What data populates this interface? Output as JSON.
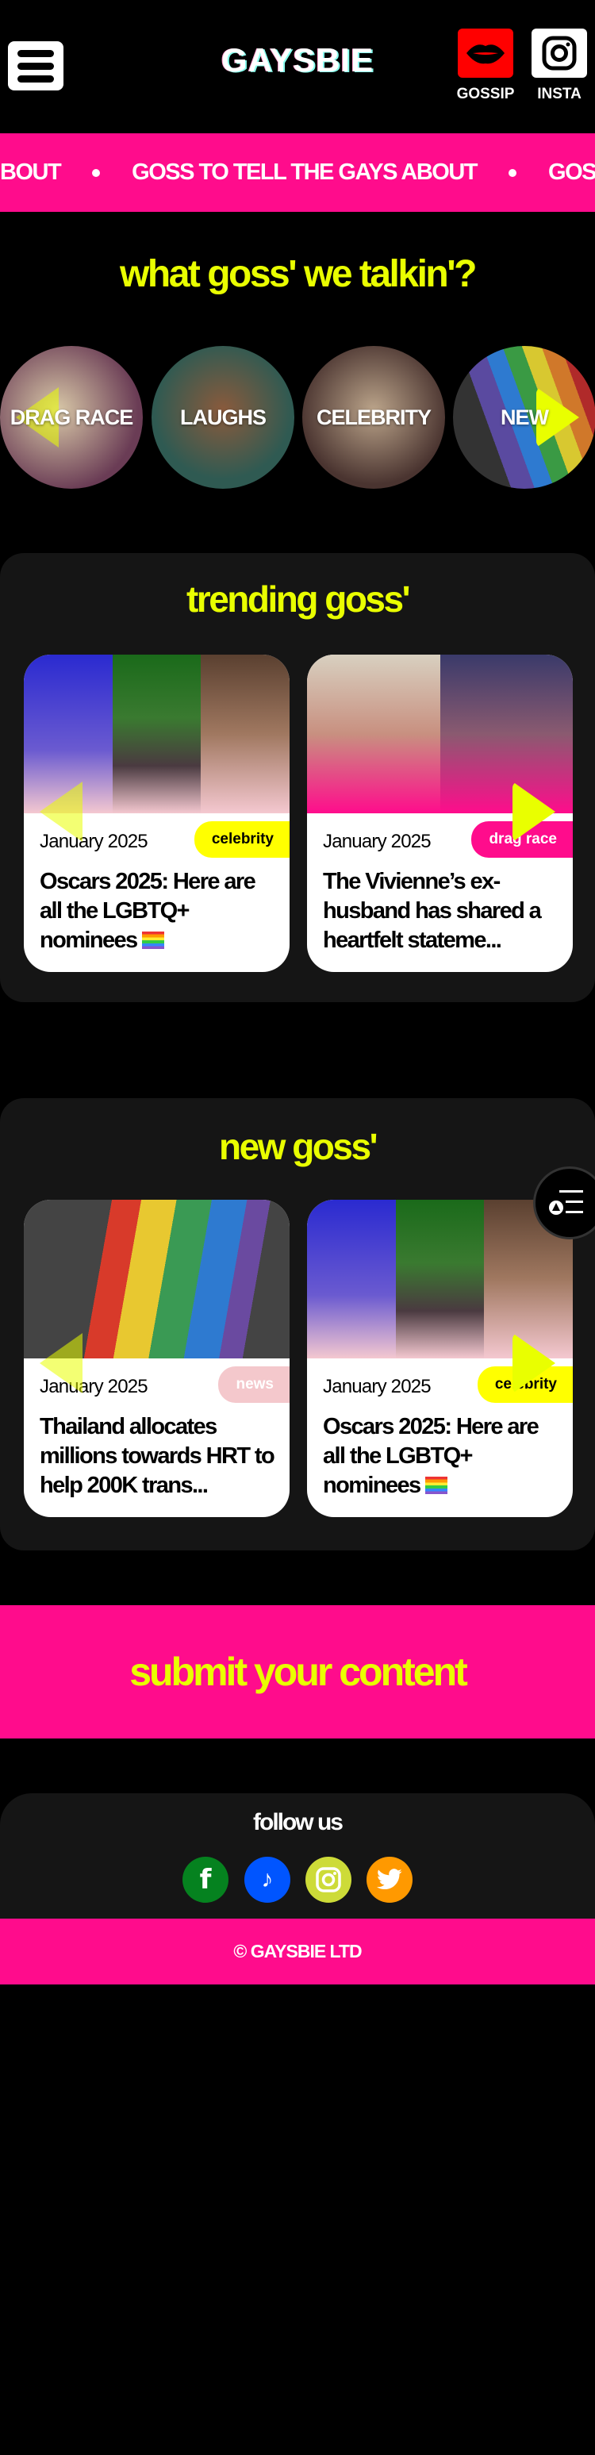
{
  "header": {
    "logo": "GAYSBIE",
    "gossip_label": "GOSSIP",
    "insta_label": "INSTA"
  },
  "ticker": {
    "items": [
      "BOUT",
      "GOSS TO TELL THE GAYS ABOUT",
      "GOSS TO"
    ]
  },
  "categories": {
    "title": "what goss' we talkin'?",
    "items": [
      {
        "label": "DRAG RACE"
      },
      {
        "label": "LAUGHS"
      },
      {
        "label": "CELEBRITY"
      },
      {
        "label": "NEW"
      }
    ]
  },
  "trending": {
    "title": "trending goss'",
    "cards": [
      {
        "date": "January 2025",
        "badge": "celebrity",
        "title": "Oscars 2025: Here are all the LGBTQ+ nominees"
      },
      {
        "date": "January 2025",
        "badge": "drag race",
        "title": "The Vivienne’s ex-husband has shared a heartfelt stateme..."
      }
    ]
  },
  "new_goss": {
    "title": "new goss'",
    "cards": [
      {
        "date": "January 2025",
        "badge": "news",
        "title": "Thailand allocates millions towards HRT to help 200K trans..."
      },
      {
        "date": "January 2025",
        "badge": "celebrity",
        "title": "Oscars 2025: Here are all the LGBTQ+ nominees"
      }
    ]
  },
  "submit": {
    "label": "submit your content"
  },
  "footer": {
    "follow_title": "follow us",
    "socials": [
      {
        "icon": "facebook-icon",
        "color": "#05821f"
      },
      {
        "icon": "tiktok-icon",
        "color": "#0055ff"
      },
      {
        "icon": "instagram-icon",
        "color": "#cddb38"
      },
      {
        "icon": "twitter-icon",
        "color": "#ff9900"
      }
    ],
    "copyright": "© GAYSBIE LTD"
  },
  "colors": {
    "pink": "#ff0c8c",
    "yellow": "#e9ff00",
    "panel": "#151515"
  }
}
